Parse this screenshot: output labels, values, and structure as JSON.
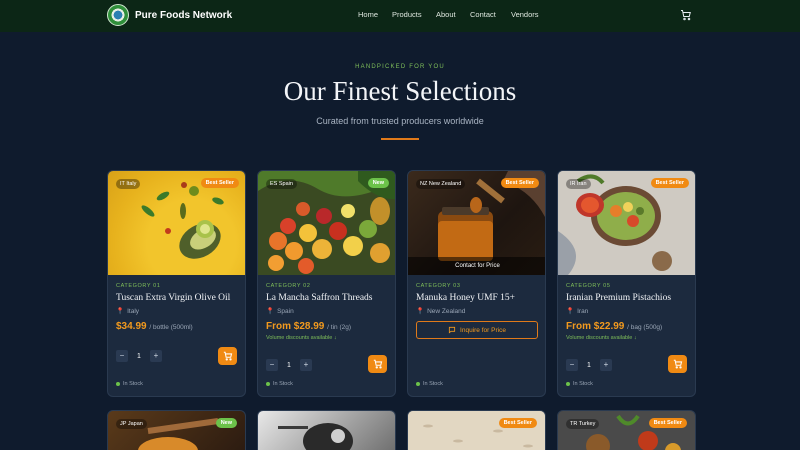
{
  "nav": {
    "brand": "Pure Foods Network",
    "items": [
      "Home",
      "Products",
      "About",
      "Contact",
      "Vendors"
    ],
    "cart_icon": "cart-icon"
  },
  "hero": {
    "eyebrow": "HANDPICKED FOR YOU",
    "title": "Our Finest Selections",
    "subtitle": "Curated from trusted producers worldwide"
  },
  "products": [
    {
      "origin_chip": "IT Italy",
      "tag": "Best Seller",
      "category": "CATEGORY 01",
      "name": "Tuscan Extra Virgin Olive Oil",
      "location": "Italy",
      "price": "$34.99",
      "unit": "/ bottle (500ml)",
      "qty": "1",
      "stock": "In Stock"
    },
    {
      "origin_chip": "ES Spain",
      "tag": "New",
      "category": "CATEGORY 02",
      "name": "La Mancha Saffron Threads",
      "location": "Spain",
      "price": "From $28.99",
      "unit": "/ tin (2g)",
      "discount": "Volume discounts available ↓",
      "qty": "1",
      "stock": "In Stock"
    },
    {
      "origin_chip": "NZ New Zealand",
      "tag": "Best Seller",
      "overlay": "Contact for Price",
      "category": "CATEGORY 03",
      "name": "Manuka Honey UMF 15+",
      "location": "New Zealand",
      "inquire": "Inquire for Price",
      "stock": "In Stock"
    },
    {
      "origin_chip": "IR Iran",
      "tag": "Best Seller",
      "category": "CATEGORY 05",
      "name": "Iranian Premium Pistachios",
      "location": "Iran",
      "price": "From $22.99",
      "unit": "/ bag (500g)",
      "discount": "Volume discounts available ↓",
      "qty": "1",
      "stock": "In Stock"
    }
  ],
  "row2": [
    {
      "origin_chip": "JP Japan",
      "tag": "New"
    },
    {},
    {
      "tag": "Best Seller"
    },
    {
      "origin_chip": "TR Turkey",
      "tag": "Best Seller"
    }
  ],
  "colors": {
    "accent": "#f08a13",
    "green": "#6cc24a",
    "nav_bg": "#0c2616",
    "page_bg": "#0f1b2d"
  }
}
